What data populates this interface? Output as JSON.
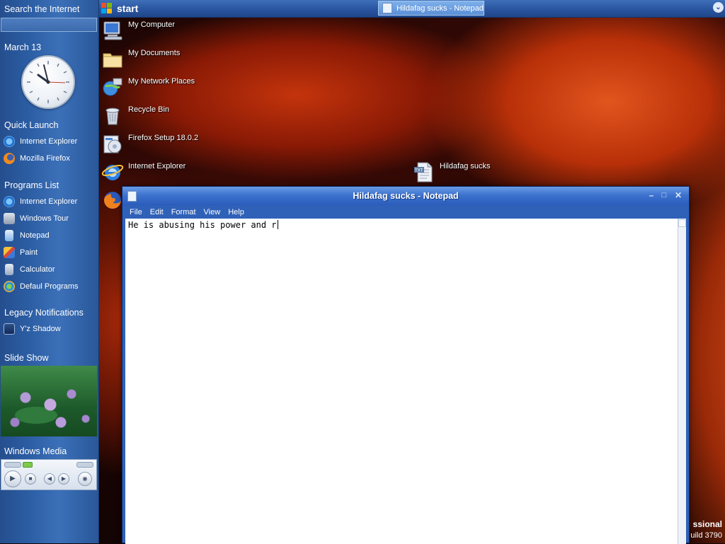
{
  "taskbar": {
    "start_label": "start",
    "task_button_label": "Hildafag sucks - Notepad"
  },
  "sidebar": {
    "search_title": "Search the Internet",
    "clock_date": "March 13",
    "quick_launch": {
      "title": "Quick Launch",
      "items": [
        {
          "label": "Internet Explorer",
          "icon": "internet-explorer-icon"
        },
        {
          "label": "Mozilla Firefox",
          "icon": "firefox-icon"
        }
      ]
    },
    "programs_list": {
      "title": "Programs List",
      "items": [
        {
          "label": "Internet Explorer",
          "icon": "internet-explorer-icon"
        },
        {
          "label": "Windows Tour",
          "icon": "windows-tour-icon"
        },
        {
          "label": "Notepad",
          "icon": "notepad-icon"
        },
        {
          "label": "Paint",
          "icon": "paint-icon"
        },
        {
          "label": "Calculator",
          "icon": "calculator-icon"
        },
        {
          "label": "Defaul Programs",
          "icon": "default-programs-icon"
        }
      ]
    },
    "legacy": {
      "title": "Legacy Notifications",
      "items": [
        {
          "label": "Y'z Shadow",
          "icon": "yz-shadow-icon"
        }
      ]
    },
    "slideshow_title": "Slide Show",
    "media_title": "Windows Media"
  },
  "desktop": {
    "icons": [
      {
        "label": "My Computer",
        "icon": "computer-icon"
      },
      {
        "label": "My Documents",
        "icon": "folder-icon"
      },
      {
        "label": "My Network Places",
        "icon": "network-icon"
      },
      {
        "label": "Recycle Bin",
        "icon": "recycle-bin-icon"
      },
      {
        "label": "Firefox Setup 18.0.2",
        "icon": "installer-icon"
      },
      {
        "label": "Internet Explorer",
        "icon": "internet-explorer-icon"
      },
      {
        "label": "Hildafag sucks",
        "icon": "text-file-icon"
      }
    ],
    "watermark_line1": "ssional",
    "watermark_line2": "uild 3790"
  },
  "notepad": {
    "title": "Hildafag sucks - Notepad",
    "menu": [
      "File",
      "Edit",
      "Format",
      "View",
      "Help"
    ],
    "content": "He is abusing his power and r"
  },
  "colors": {
    "taskbar_blue": "#2a55a0",
    "sidebar_blue": "#2c5ea4",
    "window_blue": "#2f61b8"
  }
}
